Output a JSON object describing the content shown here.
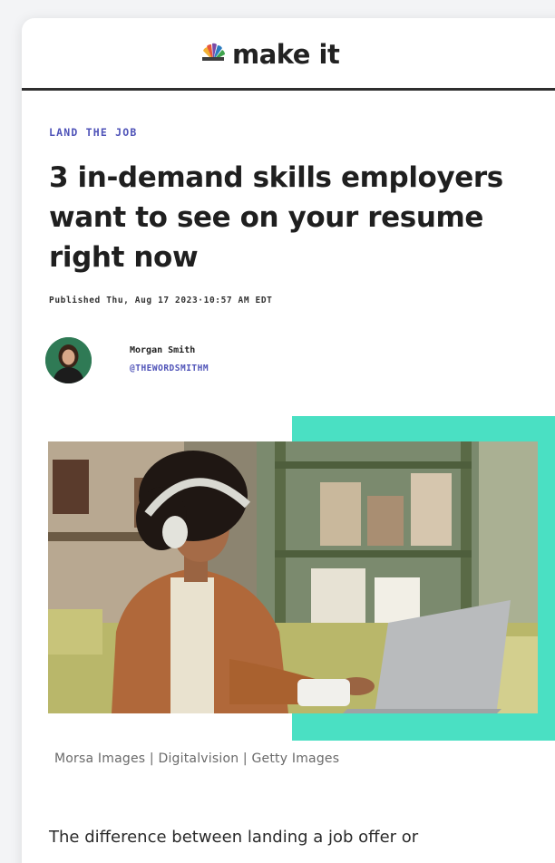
{
  "header": {
    "brand_text": "make it",
    "brand_icon": "peacock-logo-icon"
  },
  "article": {
    "kicker": "LAND THE JOB",
    "headline": "3 in-demand skills employers want to see on your resume right now",
    "published": "Published Thu, Aug 17 2023·10:57 AM EDT",
    "author": {
      "name": "Morgan Smith",
      "handle": "@THEWORDSMITHM"
    },
    "image_caption": "Morsa Images | Digitalvision | Getty Images",
    "body_first_line": "The difference between landing a job offer or"
  },
  "colors": {
    "kicker": "#4f53b8",
    "accent": "#4ae0c3",
    "headline": "#1f1f1f",
    "divider": "#2e2e2e"
  }
}
